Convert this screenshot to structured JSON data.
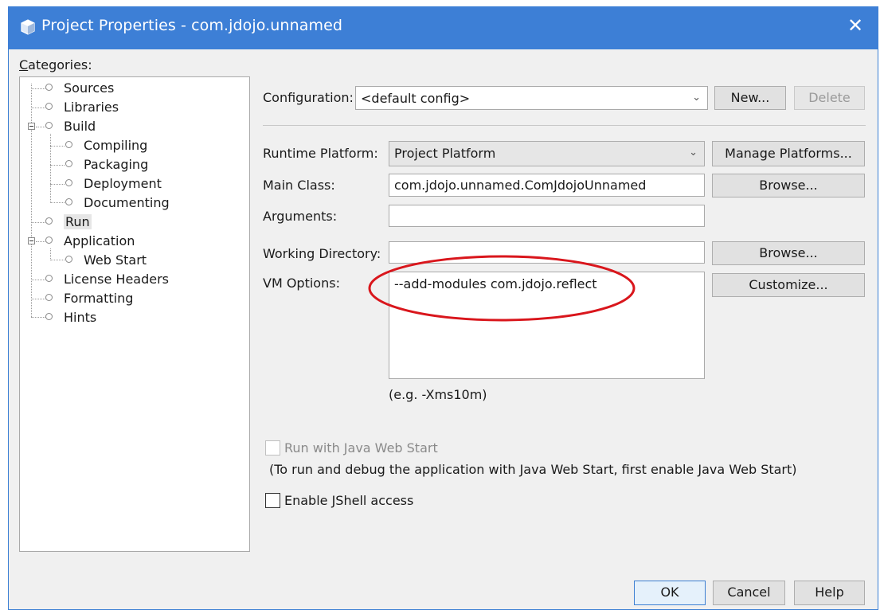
{
  "window": {
    "title": "Project Properties - com.jdojo.unnamed",
    "close_glyph": "✕"
  },
  "categories": {
    "label": "Categories:",
    "items": [
      {
        "label": "Sources"
      },
      {
        "label": "Libraries"
      },
      {
        "label": "Build"
      },
      {
        "label": "Compiling"
      },
      {
        "label": "Packaging"
      },
      {
        "label": "Deployment"
      },
      {
        "label": "Documenting"
      },
      {
        "label": "Run"
      },
      {
        "label": "Application"
      },
      {
        "label": "Web Start"
      },
      {
        "label": "License Headers"
      },
      {
        "label": "Formatting"
      },
      {
        "label": "Hints"
      }
    ],
    "selected": "Run"
  },
  "configuration": {
    "label": "Configuration:",
    "value": "<default config>",
    "new_label": "New...",
    "delete_label": "Delete"
  },
  "runtime_platform": {
    "label": "Runtime Platform:",
    "value": "Project Platform",
    "manage_label": "Manage Platforms..."
  },
  "main_class": {
    "label": "Main Class:",
    "value": "com.jdojo.unnamed.ComJdojoUnnamed",
    "browse_label": "Browse..."
  },
  "arguments": {
    "label": "Arguments:",
    "value": ""
  },
  "working_directory": {
    "label": "Working Directory:",
    "value": "",
    "browse_label": "Browse..."
  },
  "vm_options": {
    "label": "VM Options:",
    "value": "--add-modules com.jdojo.reflect",
    "customize_label": "Customize...",
    "hint": "(e.g. -Xms10m)",
    "highlight_color": "#d9161c"
  },
  "web_start": {
    "label": "Run with Java Web Start",
    "checked": false,
    "enabled": false,
    "note": "(To run and debug the application with Java Web Start, first enable Java Web Start)"
  },
  "jshell": {
    "label": "Enable JShell access",
    "checked": false
  },
  "footer": {
    "ok_label": "OK",
    "cancel_label": "Cancel",
    "help_label": "Help"
  },
  "colors": {
    "titlebar": "#3d7fd6",
    "window_bg": "#f0f0f0"
  }
}
